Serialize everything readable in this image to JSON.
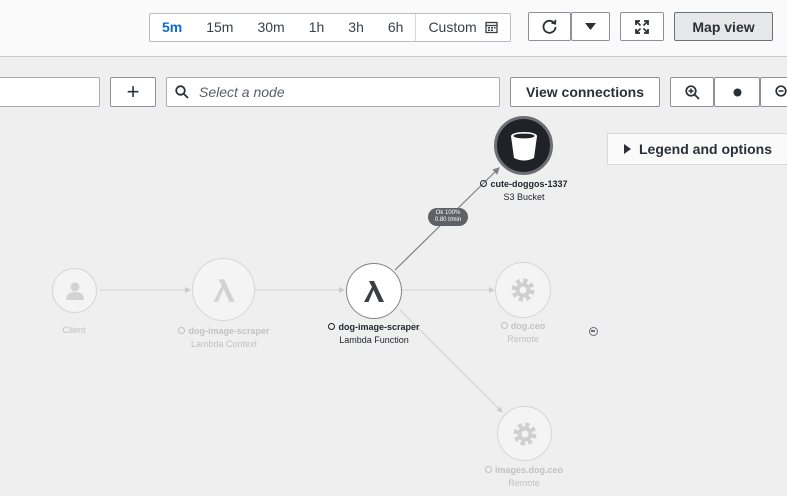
{
  "time_range": {
    "options": [
      "5m",
      "15m",
      "30m",
      "1h",
      "3h",
      "6h"
    ],
    "selected": "5m",
    "custom_label": "Custom"
  },
  "toolbar": {
    "map_view_label": "Map view",
    "view_connections_label": "View connections",
    "search_placeholder": "Select a node",
    "add_symbol": "+",
    "legend_label": "Legend and options"
  },
  "nodes": {
    "s3": {
      "name": "cute-doggos-1337",
      "type": "S3 Bucket"
    },
    "lambda": {
      "name": "dog-image-scraper",
      "type": "Lambda Function"
    },
    "client": {
      "name": "Client"
    },
    "lambda_ctx": {
      "name": "dog-image-scraper",
      "type": "Lambda Context"
    },
    "dogceo": {
      "name": "dog.ceo",
      "type": "Remote"
    },
    "images": {
      "name": "images.dog.ceo",
      "type": "Remote"
    }
  },
  "edge_badge": {
    "status": "Ok 100%",
    "rate": "0.80 t/min"
  },
  "colors": {
    "accent": "#0f6bd1",
    "node_dark": "#1f2328"
  }
}
